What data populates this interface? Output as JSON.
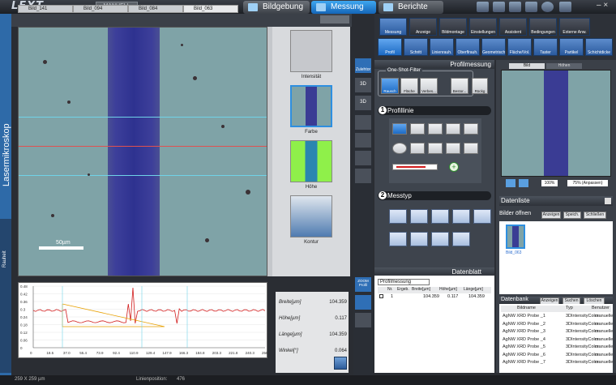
{
  "app": {
    "logo": "LEXT",
    "mode": "MANUELL"
  },
  "nav": {
    "tabs": [
      {
        "label": "Bildgebung"
      },
      {
        "label": "Messung"
      },
      {
        "label": "Berichte"
      }
    ]
  },
  "side": {
    "title": "Lasermikroskop",
    "sub": "Rauheit"
  },
  "image_tabs": [
    "Bild_141",
    "Bild_094",
    "Bild_084",
    "Bild_063"
  ],
  "image": {
    "scale": "50µm"
  },
  "thumbs": [
    {
      "label": "Intensität"
    },
    {
      "label": "Farbe"
    },
    {
      "label": "Höhe"
    },
    {
      "label": "Kontur"
    }
  ],
  "graph": {
    "yticks": [
      "0.48",
      "0.42",
      "0.36",
      "0.3",
      "0.24",
      "0.18",
      "0.12",
      "0.06",
      "0"
    ],
    "xticks": [
      "0",
      "18.5",
      "37.0",
      "55.4",
      "73.9",
      "92.4",
      "110.9",
      "129.4",
      "147.9",
      "166.3",
      "184.8",
      "203.3",
      "221.8",
      "240.3",
      "258.7"
    ]
  },
  "results": [
    {
      "label": "Breite[µm]",
      "value": "104.359"
    },
    {
      "label": "Höhe[µm]",
      "value": "0.117"
    },
    {
      "label": "Länge[µm]",
      "value": "104.359"
    },
    {
      "label": "Winkel[°]",
      "value": "0.064"
    }
  ],
  "tools_top": [
    "Messung",
    "Anzeige",
    "Bildmontage",
    "Einstellungen",
    "Assistent",
    "Bedingungen",
    "Externe Anw."
  ],
  "tools_second": [
    "Profil",
    "Schritt",
    "Linienrauh.",
    "Oberflrauh.",
    "Geometrisch",
    "Fläche/Vol.",
    "Taster",
    "Partikel",
    "Schichtdicke"
  ],
  "left_tools": [
    "Zulehtor",
    "3D",
    "3D"
  ],
  "profil": {
    "title": "Profilmessung",
    "filter_title": "One-Shot-Filter",
    "filters": [
      "Rausch",
      "Fläche",
      "Verbes...",
      "Bestor...",
      "Rückg"
    ],
    "sect1": "Profillinie",
    "sect2": "Messtyp",
    "num1": "1",
    "num2": "2"
  },
  "datenblatt": {
    "title": "Datenblatt",
    "select": "Profilmessung",
    "cols": [
      "Nr.",
      "Ergeb.",
      "Breite[µm]",
      "Höhe[µm]",
      "Länge[µm]"
    ],
    "row": [
      "1",
      "",
      "104.359",
      "0.117",
      "104.359"
    ]
  },
  "zoom": {
    "value": "100%",
    "fit": "75% (Anpassen)"
  },
  "preview_tabs": [
    "Bild",
    "Höhen"
  ],
  "datenliste": {
    "title": "Datenliste",
    "bilder": "Bilder öffnen",
    "btns": [
      "Anzeigen",
      "Speich.",
      "Schließen"
    ],
    "thumb": "Bild_063"
  },
  "bank": {
    "title": "Datenbank",
    "btns": [
      "Anzeigen",
      "Suchen",
      "Löschen"
    ],
    "cols": [
      "Bildname",
      "Typ",
      "Benutzer"
    ],
    "rows": [
      [
        "AgNW XRD Probe _1",
        "3DIntensityColor",
        "manuelle"
      ],
      [
        "AgNW XRD Probe _2",
        "3DIntensityColor",
        "manuelle"
      ],
      [
        "AgNW XRD Probe _3",
        "3DIntensityColor",
        "manuelle"
      ],
      [
        "AgNW XRD Probe _4",
        "3DIntensityColor",
        "manuelle"
      ],
      [
        "AgNW XRD Probe _5",
        "3DIntensityColor",
        "manuelle"
      ],
      [
        "AgNW XRD Probe _6",
        "3DIntensityColor",
        "manuelle"
      ],
      [
        "AgNW XRD Probe _7",
        "3DIntensityColor",
        "manuelle"
      ]
    ]
  },
  "status": {
    "size": "259 X 259 µm",
    "pos_label": "Linienposition:",
    "pos": "476"
  },
  "zoom_label": "ZOOM",
  "zoom_sub": "Profil"
}
